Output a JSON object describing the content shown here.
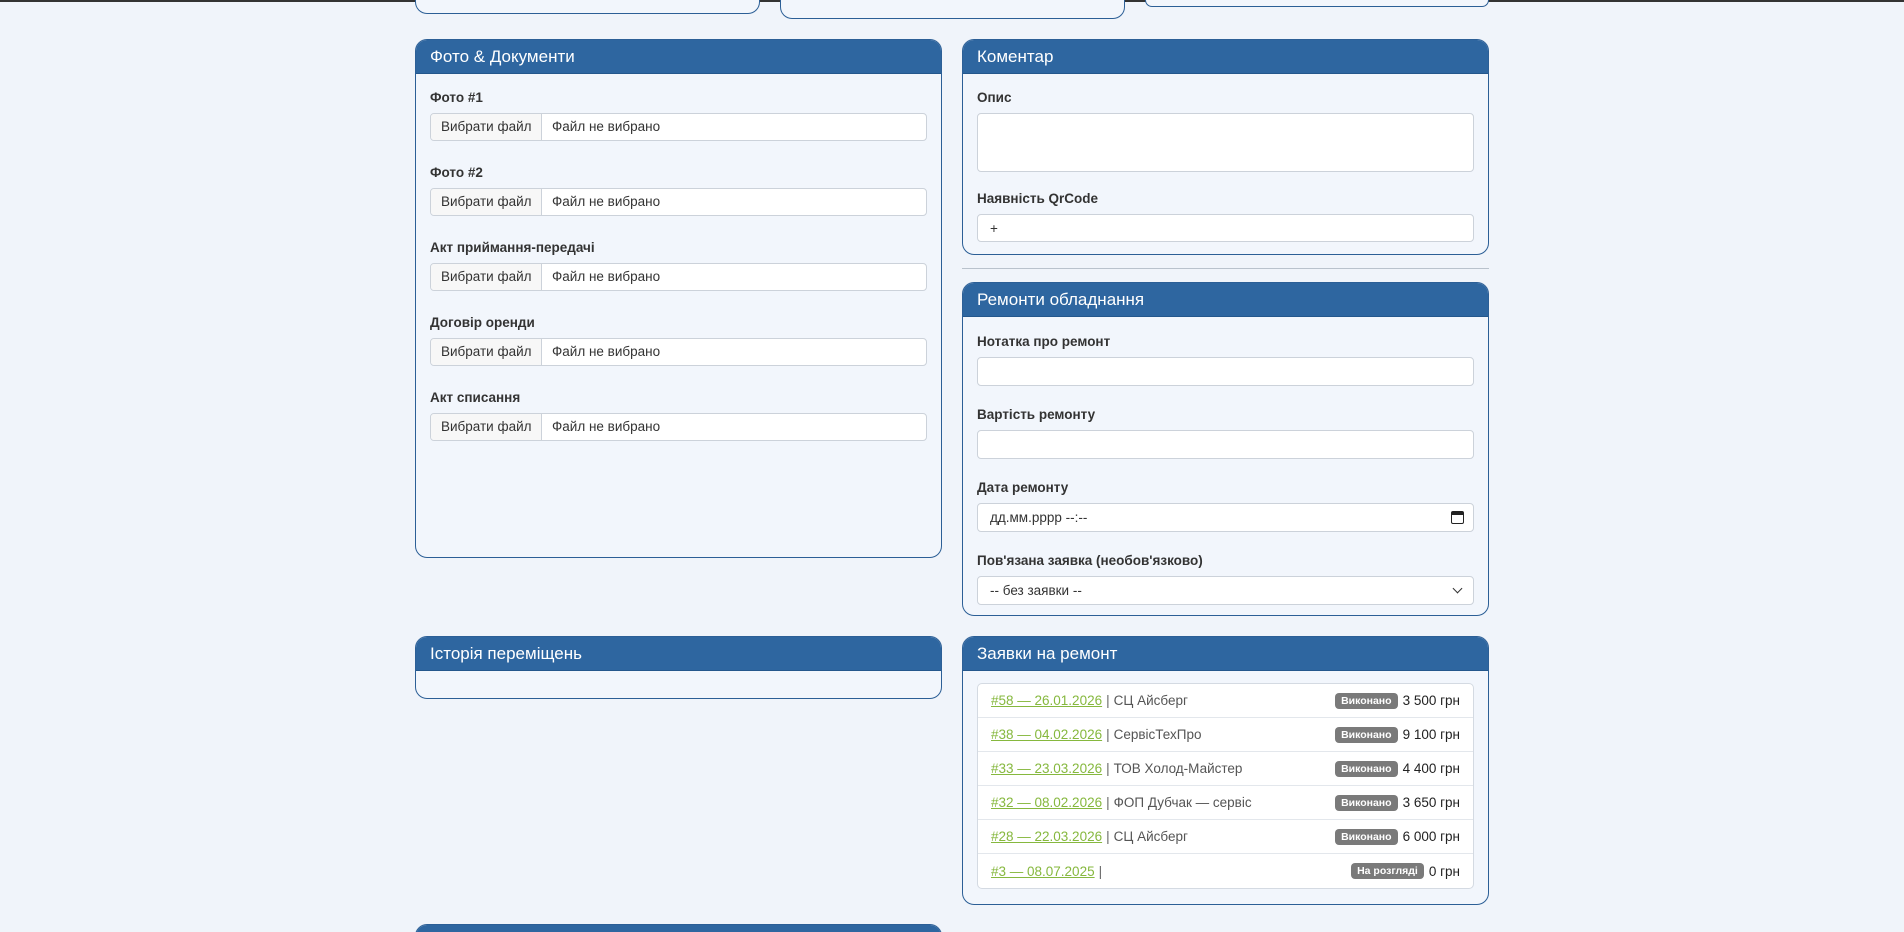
{
  "photos_docs": {
    "title": "Фото & Документи",
    "fields": [
      {
        "label": "Фото #1",
        "button": "Вибрати файл",
        "file": "Файл не вибрано"
      },
      {
        "label": "Фото #2",
        "button": "Вибрати файл",
        "file": "Файл не вибрано"
      },
      {
        "label": "Акт приймання-передачі",
        "button": "Вибрати файл",
        "file": "Файл не вибрано"
      },
      {
        "label": "Договір оренди",
        "button": "Вибрати файл",
        "file": "Файл не вибрано"
      },
      {
        "label": "Акт списання",
        "button": "Вибрати файл",
        "file": "Файл не вибрано"
      }
    ]
  },
  "comment": {
    "title": "Коментар",
    "description_label": "Опис",
    "description_value": "",
    "qr_label": "Наявність QrCode",
    "qr_value": "+"
  },
  "repairs": {
    "title": "Ремонти обладнання",
    "note_label": "Нотатка про ремонт",
    "note_value": "",
    "cost_label": "Вартість ремонту",
    "cost_value": "",
    "date_label": "Дата ремонту",
    "date_value": "дд.мм.рррр --:--",
    "linked_label": "Пов'язана заявка (необов'язково)",
    "linked_value": "-- без заявки --"
  },
  "history": {
    "title": "Історія переміщень"
  },
  "requests": {
    "title": "Заявки на ремонт",
    "separator": "|",
    "items": [
      {
        "link": "#58 — 26.01.2026",
        "vendor": "СЦ Айсберг",
        "status": "Виконано",
        "price": "3 500 грн"
      },
      {
        "link": "#38 — 04.02.2026",
        "vendor": "СервісТехПро",
        "status": "Виконано",
        "price": "9 100 грн"
      },
      {
        "link": "#33 — 23.03.2026",
        "vendor": "ТОВ Холод-Майстер",
        "status": "Виконано",
        "price": "4 400 грн"
      },
      {
        "link": "#32 — 08.02.2026",
        "vendor": "ФОП Дубчак — сервіс",
        "status": "Виконано",
        "price": "3 650 грн"
      },
      {
        "link": "#28 — 22.03.2026",
        "vendor": "СЦ Айсберг",
        "status": "Виконано",
        "price": "6 000 грн"
      },
      {
        "link": "#3 — 08.07.2025",
        "vendor": "",
        "status": "На розгляді",
        "price": "0 грн"
      }
    ]
  }
}
